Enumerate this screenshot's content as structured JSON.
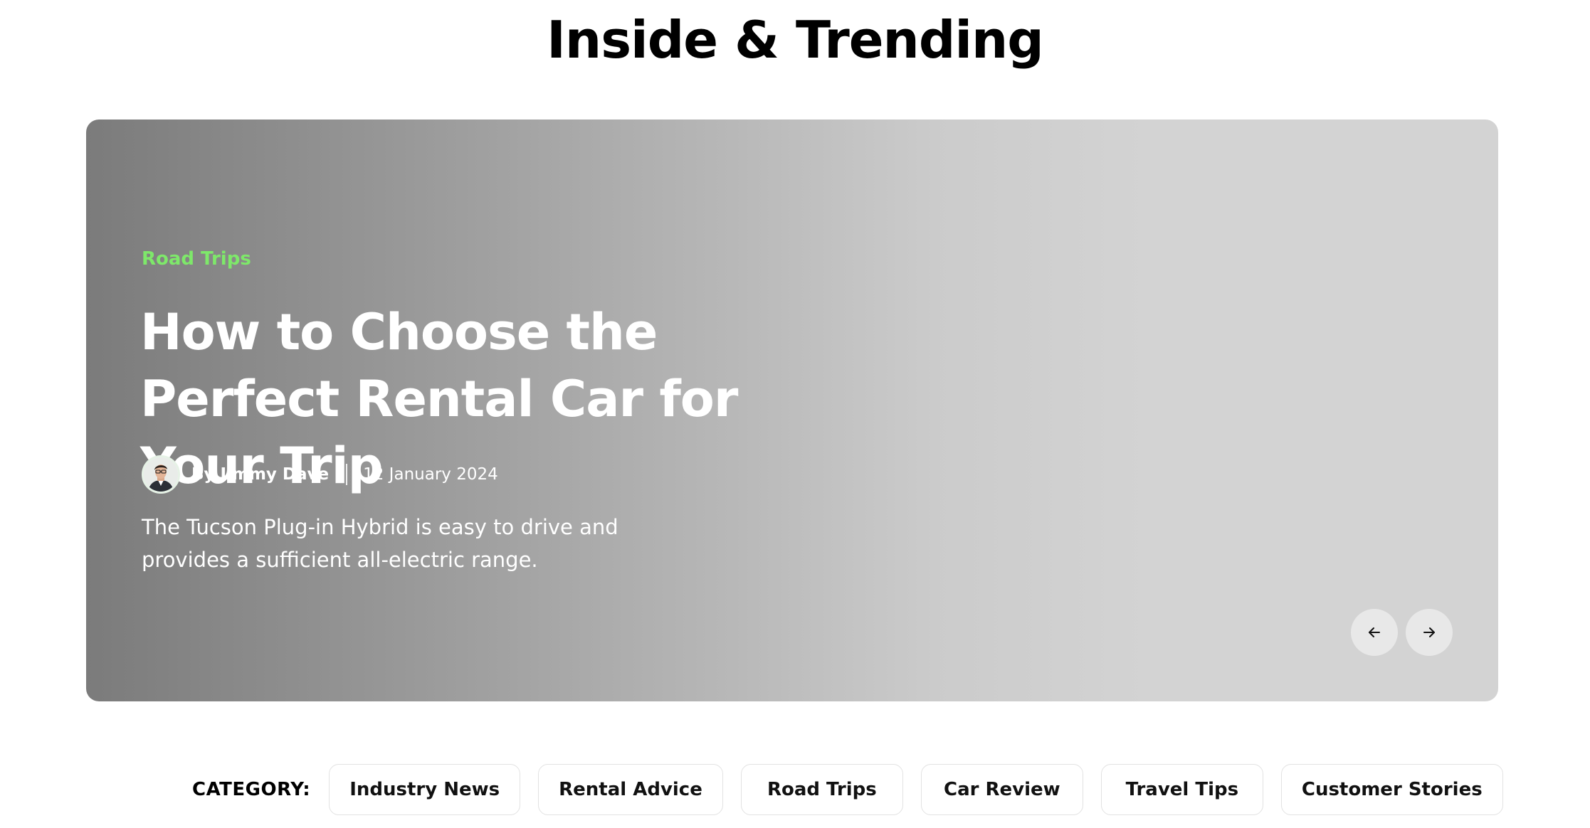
{
  "section": {
    "title": "Inside & Trending"
  },
  "hero": {
    "category": "Road Trips",
    "headline": "How to Choose the Perfect Rental Car for Your Trip",
    "author": "By Jimmy Dave",
    "date": "12 January 2024",
    "excerpt": "The Tucson Plug-in Hybrid is easy to drive and provides a sufficient all-electric range.",
    "category_color": "#7ee86a",
    "prev_icon": "arrow-left-icon",
    "next_icon": "arrow-right-icon"
  },
  "categories": {
    "label": "CATEGORY:",
    "items": [
      {
        "label": "Industry News"
      },
      {
        "label": "Rental Advice"
      },
      {
        "label": "Road Trips"
      },
      {
        "label": "Car Review"
      },
      {
        "label": "Travel Tips"
      },
      {
        "label": "Customer Stories"
      }
    ]
  }
}
